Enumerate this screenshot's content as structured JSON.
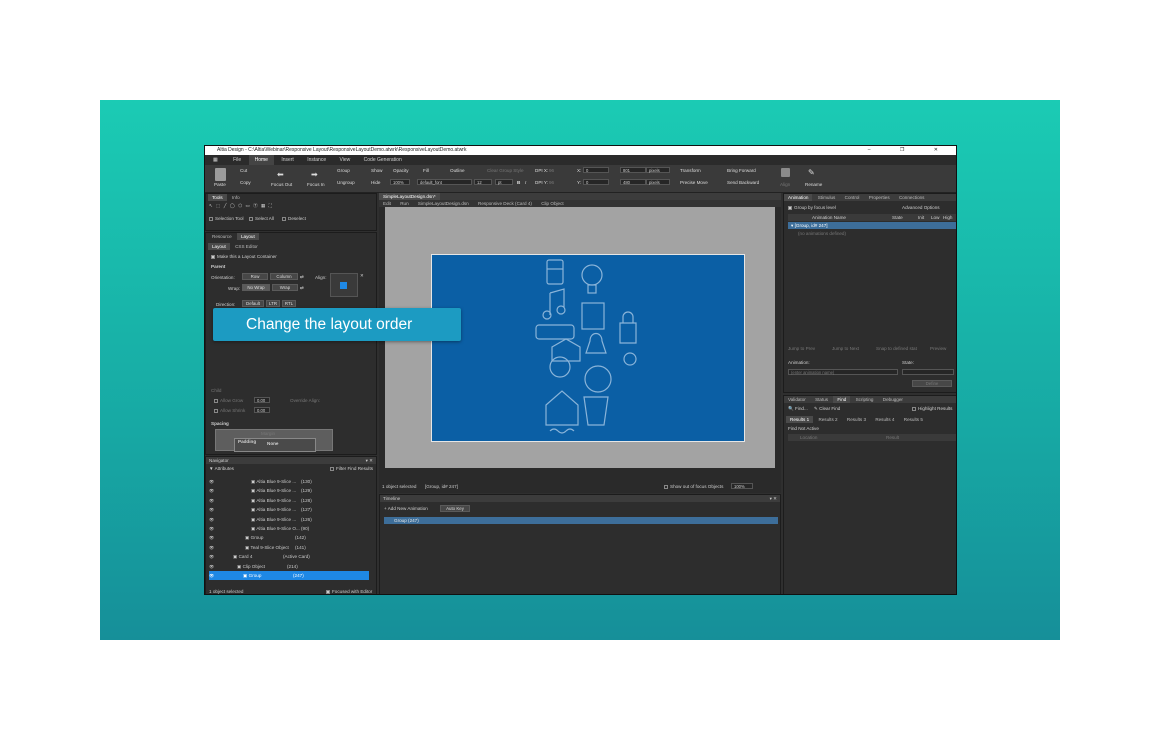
{
  "window": {
    "title": "Altia Design - C:\\Altia\\Webinar\\Responsive Layout\\ResponsiveLayoutDemo.atwrk\\ResponsiveLayoutDemo.atwrk",
    "controls": [
      "–",
      "❐",
      "✕"
    ]
  },
  "menu": [
    "File",
    "Home",
    "Insert",
    "Instance",
    "View",
    "Code Generation"
  ],
  "menu_active": "Home",
  "ribbon": {
    "paste": "Paste",
    "cut": "Cut",
    "copy": "Copy",
    "focus_out": "Focus Out",
    "focus_in": "Focus In",
    "group": "Group",
    "ungroup": "Ungroup",
    "show": "Show",
    "hide": "Hide",
    "opacity": "Opacity",
    "opacity_value": "100%",
    "fill": "Fill",
    "outline": "Outline",
    "clear_group_style": "Clear Group Style",
    "font": "default_font",
    "font_size": "12",
    "font_unit": "pt",
    "bold": "B",
    "italic": "I",
    "dpi_x_label": "DPI X:",
    "dpi_x": "96",
    "dpi_y_label": "DPI Y:",
    "dpi_y": "96",
    "x_label": "X:",
    "x_value": "0",
    "y_label": "Y:",
    "y_value": "0",
    "w_value": "801",
    "h_value": "480",
    "unit1": "pixels",
    "unit2": "pixels",
    "transform": "Transform",
    "precise_move": "Precise Move",
    "bring_forward": "Bring Forward",
    "send_backward": "Send Backward",
    "align": "Align",
    "rename": "Rename"
  },
  "tools_panel": {
    "tabs": [
      "Tools",
      "Info"
    ],
    "selection_tool": "Selection Tool",
    "select_all": "Select All",
    "deselect": "Deselect"
  },
  "layout_panel": {
    "tabs": [
      "Resource",
      "Layout"
    ],
    "subtabs": [
      "Layout",
      "CSS Editor"
    ],
    "make_container": "Make this a Layout Container",
    "parent": "Parent",
    "orientation": "Orientation:",
    "row": "Row",
    "column": "Column",
    "align": "Align:",
    "wrap_label": "Wrap:",
    "no_wrap": "No Wrap",
    "wrap": "Wrap",
    "direction": "Direction:",
    "default": "Default",
    "ltr": "LTR",
    "rtl": "RTL",
    "child": "Child",
    "allow_grow": "Allow Grow",
    "allow_shrink": "Allow Shrink",
    "grow_value": "0.00",
    "shrink_value": "0.00",
    "override_align": "Override Align:",
    "spacing": "Spacing",
    "margin": "Margin",
    "padding": "Padding",
    "none": "None",
    "position": "Position"
  },
  "overlay": {
    "text": "Change the layout order"
  },
  "document": {
    "tabs": [
      "SimpleLayoutDesign.dsn*"
    ],
    "toolbar": [
      "Edit",
      "Run"
    ],
    "breadcrumb": [
      "SimpleLayoutDesign.dsn",
      "Responsive Deck (Card 4)",
      "Clip Object"
    ],
    "status": "1 object selected",
    "status_obj": "[Group, id# 247]",
    "show_out_of_focus": "Show out of focus Objects",
    "zoom": "100%"
  },
  "navigator": {
    "title": "Navigator",
    "attributes": "Attributes",
    "filter": "Filter Find Results",
    "rows": [
      {
        "name": "Altia Blue 9-Slice ...",
        "id": "(130)",
        "sel": false
      },
      {
        "name": "Altia Blue 9-Slice ...",
        "id": "(129)",
        "sel": false
      },
      {
        "name": "Altia Blue 9-Slice ...",
        "id": "(128)",
        "sel": false
      },
      {
        "name": "Altia Blue 9-Slice ...",
        "id": "(127)",
        "sel": false
      },
      {
        "name": "Altia Blue 9-Slice ...",
        "id": "(126)",
        "sel": false
      },
      {
        "name": "Altia Blue 9-Slice O...",
        "id": "(90)",
        "sel": false
      },
      {
        "name": "Group",
        "id": "(142)",
        "sel": false
      },
      {
        "name": "Teal 9-Slice Object",
        "id": "(141)",
        "sel": false
      },
      {
        "name": "Card 4",
        "id": "(Active Card)",
        "sel": false
      },
      {
        "name": "Clip Object",
        "id": "(214)",
        "sel": false
      },
      {
        "name": "Group",
        "id": "(247)",
        "sel": true
      }
    ],
    "status": "1 object selected",
    "focused": "Focused with Editor"
  },
  "timeline": {
    "title": "Timeline",
    "add_new": "Add New Animation",
    "auto_key": "Auto Key",
    "row": "Group (247)"
  },
  "animation_panel": {
    "tabs": [
      "Animation",
      "Stimulus",
      "Control",
      "Properties",
      "Connections"
    ],
    "group_by": "Group by focus level",
    "advanced": "Advanced Options",
    "columns": [
      "Animation Name",
      "State",
      "Init",
      "Low",
      "High"
    ],
    "group_row": "[Group, id# 247]",
    "no_anim": "(no animations defined)",
    "jump_prev": "Jump to Prev",
    "jump_next": "Jump to Next",
    "snap": "Snap to defined stat",
    "preview": "Preview",
    "animation_label": "Animation:",
    "state_label": "State:",
    "animation_placeholder": "(enter animation name)",
    "define": "Define"
  },
  "find_panel": {
    "tabs": [
      "Validator",
      "Status",
      "Find",
      "Scripting",
      "Debugger"
    ],
    "find": "Find...",
    "clear_find": "Clear Find",
    "highlight": "Highlight Results",
    "results": [
      "Results 1",
      "Results 2",
      "Results 3",
      "Results 4",
      "Results 5"
    ],
    "find_not_active": "Find Not Active",
    "col_location": "Location",
    "col_result": "Result"
  }
}
